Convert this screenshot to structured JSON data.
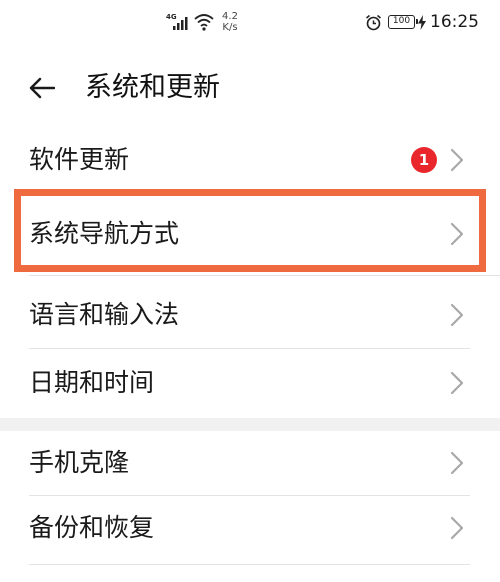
{
  "status_bar": {
    "network_type": "4G",
    "net_speed_value": "4.2",
    "net_speed_unit": "K/s",
    "battery_level": "100",
    "time": "16:25",
    "icons": [
      "signal-icon",
      "wifi-icon",
      "alarm-icon",
      "battery-icon",
      "charging-bolt-icon"
    ]
  },
  "header": {
    "title": "系统和更新",
    "back_icon": "arrow-left-icon"
  },
  "menu": {
    "group1": [
      {
        "label": "软件更新",
        "badge": "1"
      },
      {
        "label": "系统导航方式",
        "highlighted": true
      },
      {
        "label": "语言和输入法"
      },
      {
        "label": "日期和时间"
      }
    ],
    "group2": [
      {
        "label": "手机克隆"
      },
      {
        "label": "备份和恢复"
      }
    ]
  },
  "colors": {
    "page_background": "#f1f1f1",
    "card_background": "#ffffff",
    "badge": "#e8262b",
    "highlight_outline": "#f06a3f",
    "chevron": "#a8a8a8"
  }
}
